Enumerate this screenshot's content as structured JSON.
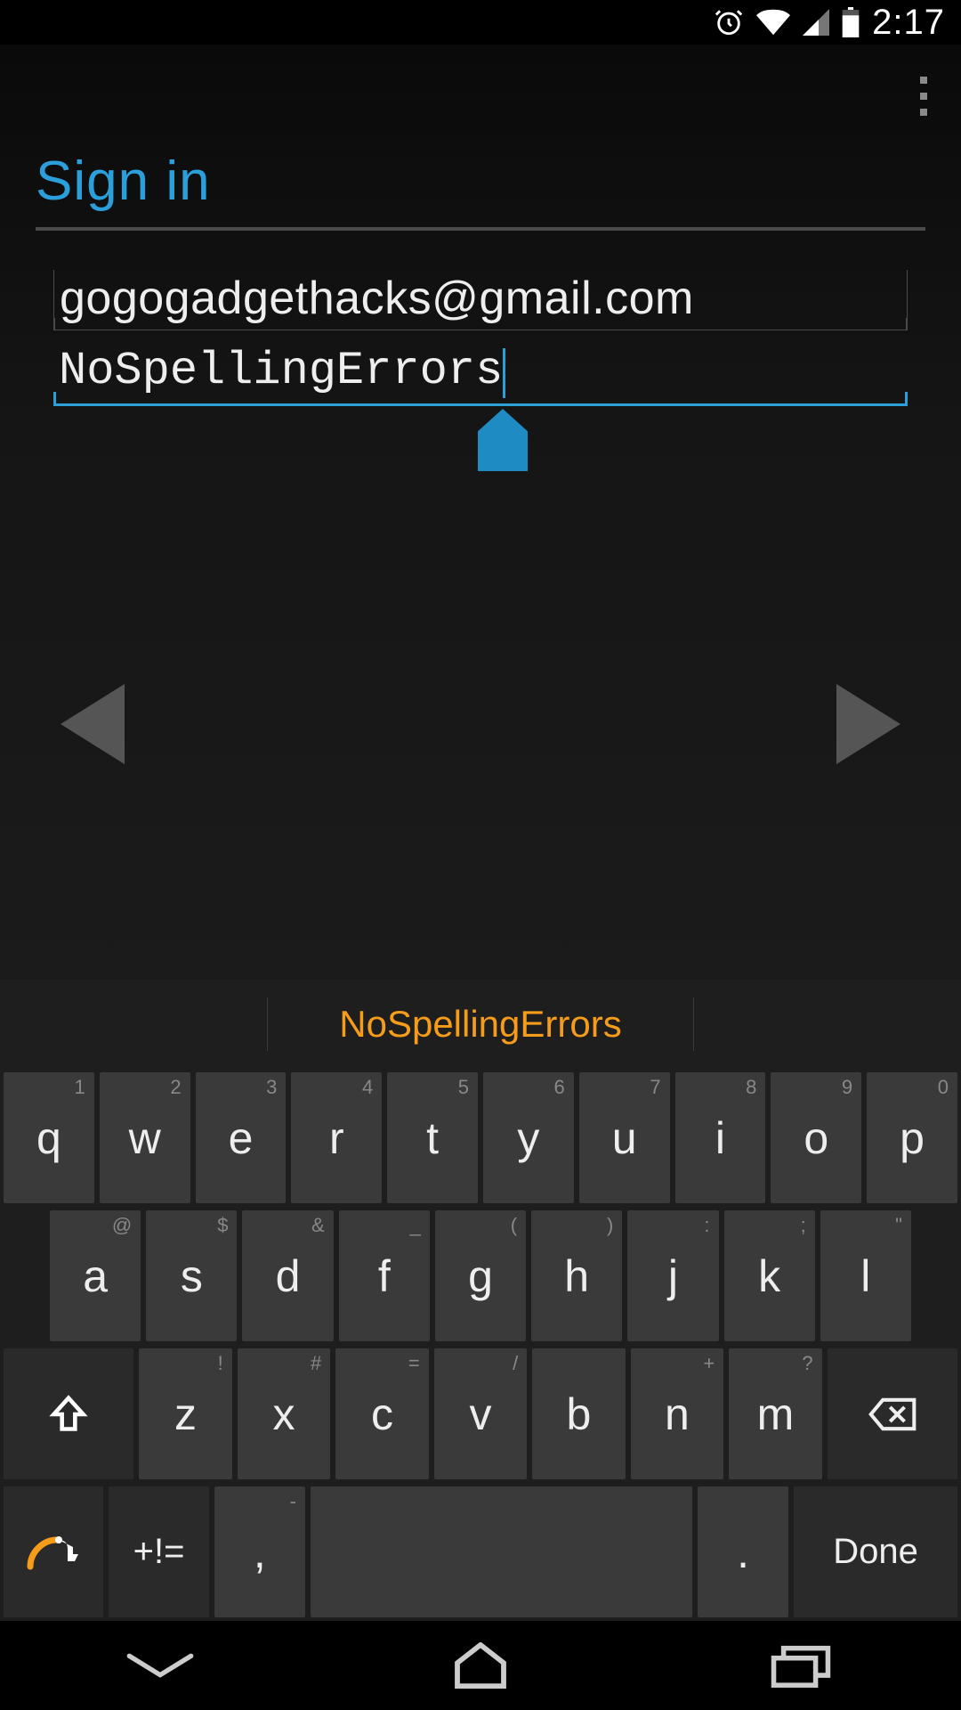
{
  "status": {
    "time": "2:17"
  },
  "header": {
    "title": "Sign in"
  },
  "form": {
    "email_value": "gogogadgethacks@gmail.com",
    "password_value": "NoSpellingErrors"
  },
  "suggestion": "NoSpellingErrors",
  "keyboard": {
    "row1": [
      {
        "main": "q",
        "sec": "1"
      },
      {
        "main": "w",
        "sec": "2"
      },
      {
        "main": "e",
        "sec": "3"
      },
      {
        "main": "r",
        "sec": "4"
      },
      {
        "main": "t",
        "sec": "5"
      },
      {
        "main": "y",
        "sec": "6"
      },
      {
        "main": "u",
        "sec": "7"
      },
      {
        "main": "i",
        "sec": "8"
      },
      {
        "main": "o",
        "sec": "9"
      },
      {
        "main": "p",
        "sec": "0"
      }
    ],
    "row2": [
      {
        "main": "a",
        "sec": "@"
      },
      {
        "main": "s",
        "sec": "$"
      },
      {
        "main": "d",
        "sec": "&"
      },
      {
        "main": "f",
        "sec": "_"
      },
      {
        "main": "g",
        "sec": "("
      },
      {
        "main": "h",
        "sec": ")"
      },
      {
        "main": "j",
        "sec": ":"
      },
      {
        "main": "k",
        "sec": ";"
      },
      {
        "main": "l",
        "sec": "\""
      }
    ],
    "row3": [
      {
        "main": "z",
        "sec": "!"
      },
      {
        "main": "x",
        "sec": "#"
      },
      {
        "main": "c",
        "sec": "="
      },
      {
        "main": "v",
        "sec": "/"
      },
      {
        "main": "b",
        "sec": ""
      },
      {
        "main": "n",
        "sec": "+"
      },
      {
        "main": "m",
        "sec": "?"
      }
    ],
    "sym_label": "+!=",
    "comma_label": ",",
    "comma_sec": "-",
    "period_label": ".",
    "done_label": "Done"
  }
}
